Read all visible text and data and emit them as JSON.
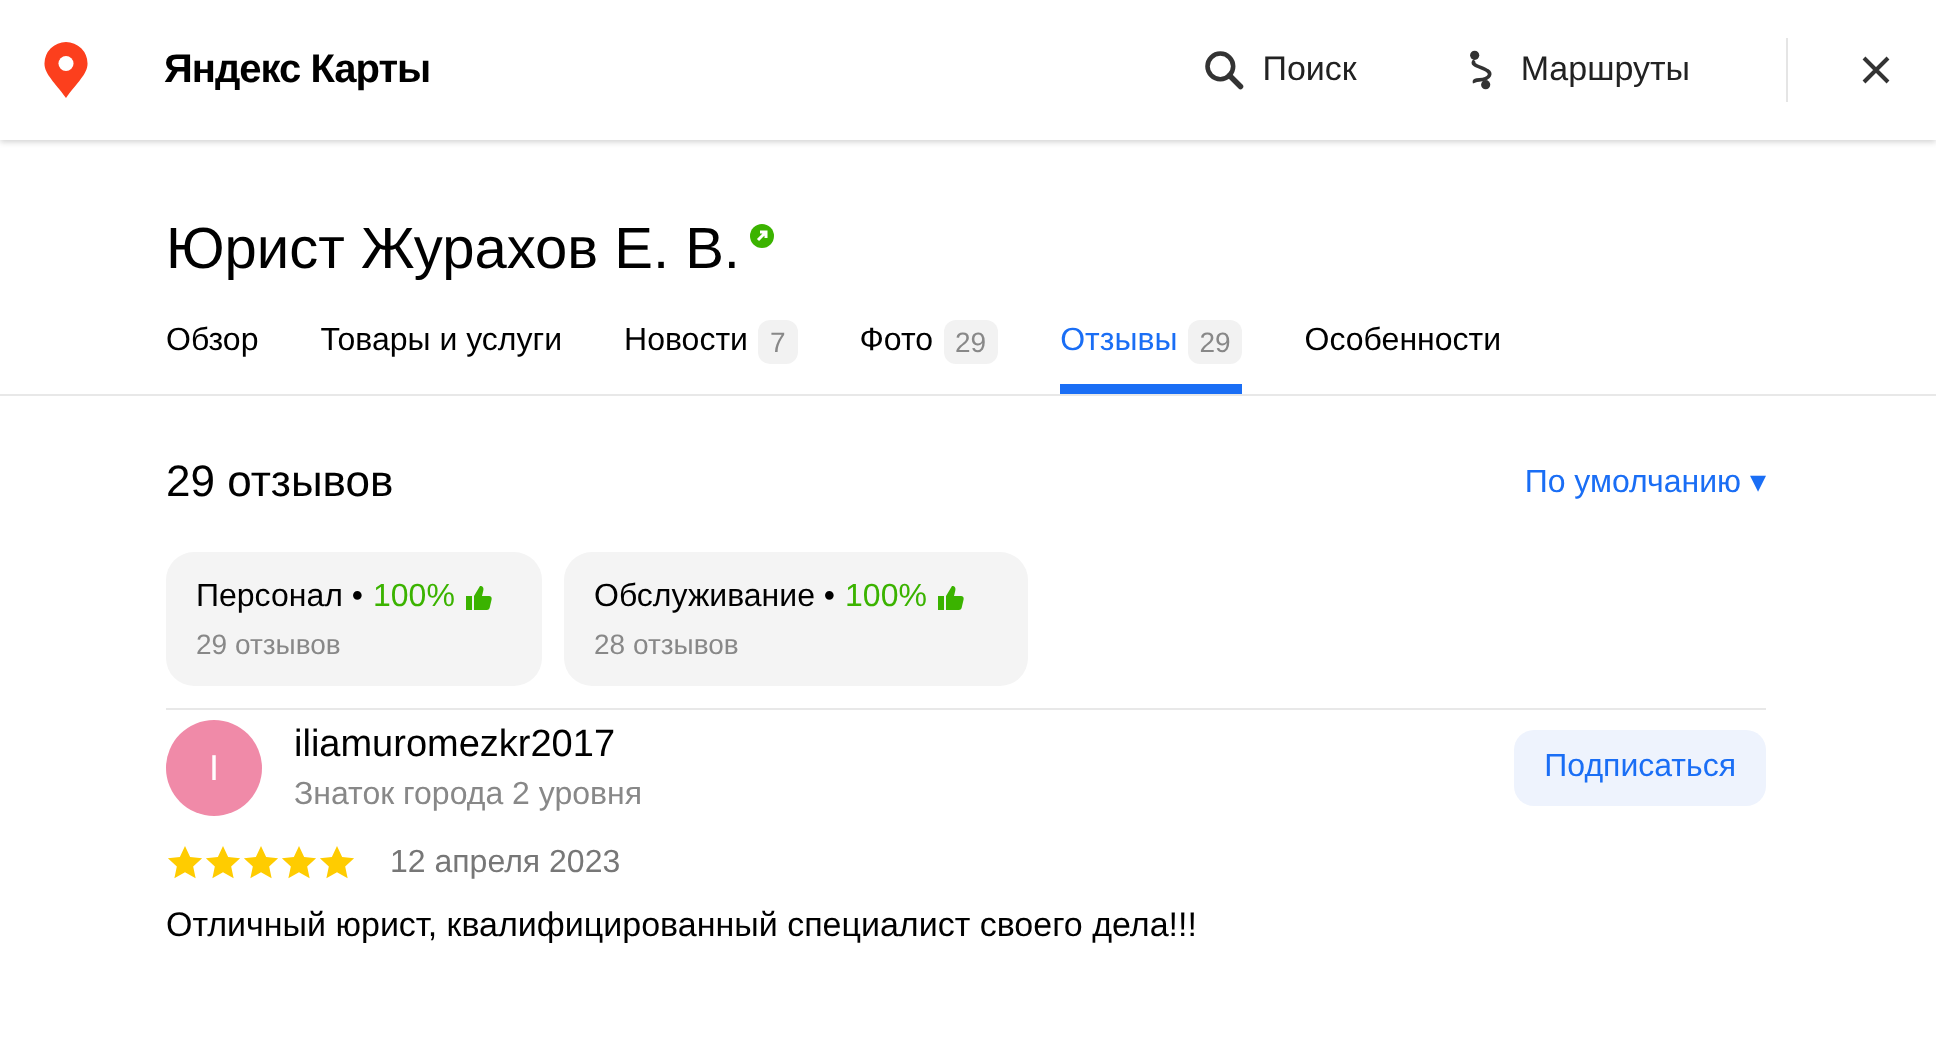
{
  "header": {
    "brand": "Яндекс Карты",
    "actions": [
      {
        "kind": "search",
        "label": "Поиск"
      },
      {
        "kind": "route",
        "label": "Маршруты"
      }
    ]
  },
  "org": {
    "title": "Юрист Журахов Е. В.",
    "verified": true
  },
  "tabs": [
    {
      "label": "Обзор",
      "selected": false
    },
    {
      "label": "Товары и услуги",
      "selected": false
    },
    {
      "label": "Новости",
      "count": "7",
      "selected": false
    },
    {
      "label": "Фото",
      "count": "29",
      "selected": false
    },
    {
      "label": "Отзывы",
      "count": "29",
      "selected": true
    },
    {
      "label": "Особенности",
      "selected": false
    }
  ],
  "reviews_heading": "29 отзывов",
  "sort": "По умолчанию ▾",
  "aspects": [
    {
      "name": "Персонал •",
      "percent": "100%",
      "count": "29 отзывов"
    },
    {
      "name": "Обслуживание •",
      "percent": "100%",
      "count": "28 отзывов"
    }
  ],
  "review": {
    "avatar_letter": "I",
    "author": "iliamuromezkr2017",
    "badge": "Знаток города 2 уровня",
    "subscribe": "Подписаться",
    "stars": 5,
    "date": "12 апреля 2023",
    "text": "Отличный юрист, квалифицированный специалист своего дела!!!"
  }
}
